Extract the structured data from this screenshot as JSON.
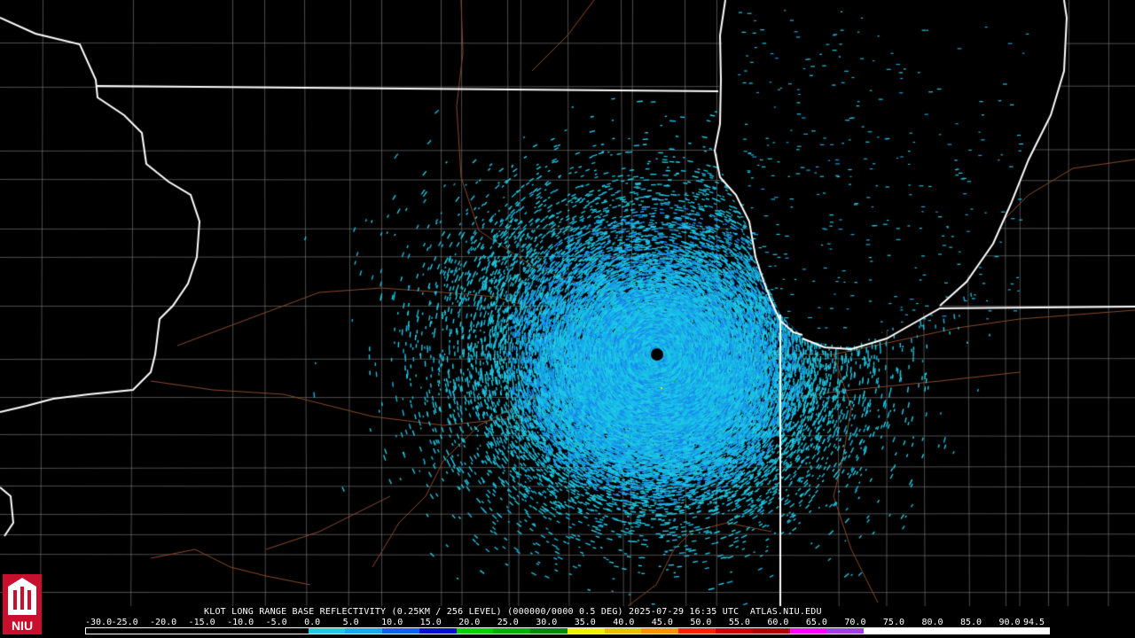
{
  "header": {
    "title": "KLOT LONG RANGE BASE REFLECTIVITY (0.25KM / 256 LEVEL) (000000/0000 0.5 DEG) 2025-07-29 16:35 UTC  ATLAS.NIU.EDU"
  },
  "logo": {
    "text": "NIU",
    "icon": "university-tower-icon",
    "color": "#c8102e"
  },
  "colors": {
    "background": "#000000",
    "state_borders": "#ffffff",
    "county_lines": "#8c8c8c",
    "rivers_roads": "#8a4a2a",
    "radar_site": "#000000"
  },
  "colorbar": {
    "labels": [
      "-30.0",
      "-25.0",
      "-20.0",
      "-15.0",
      "-10.0",
      "-5.0",
      "0.0",
      "5.0",
      "10.0",
      "15.0",
      "20.0",
      "25.0",
      "30.0",
      "35.0",
      "40.0",
      "45.0",
      "50.0",
      "55.0",
      "60.0",
      "65.0",
      "70.0",
      "75.0",
      "80.0",
      "85.0",
      "90.0",
      "94.5"
    ],
    "colors": [
      "#000000",
      "#000000",
      "#000000",
      "#000000",
      "#000000",
      "#000000",
      "#20c8e0",
      "#18a8f0",
      "#1060f0",
      "#0010d0",
      "#00d000",
      "#00b000",
      "#008800",
      "#f0f000",
      "#e8c000",
      "#ff9000",
      "#ff2000",
      "#d00000",
      "#b00000",
      "#ff00ff",
      "#a040e0",
      "#ffffff",
      "#ffffff",
      "#ffffff",
      "#ffffff",
      "#ffffff"
    ]
  }
}
